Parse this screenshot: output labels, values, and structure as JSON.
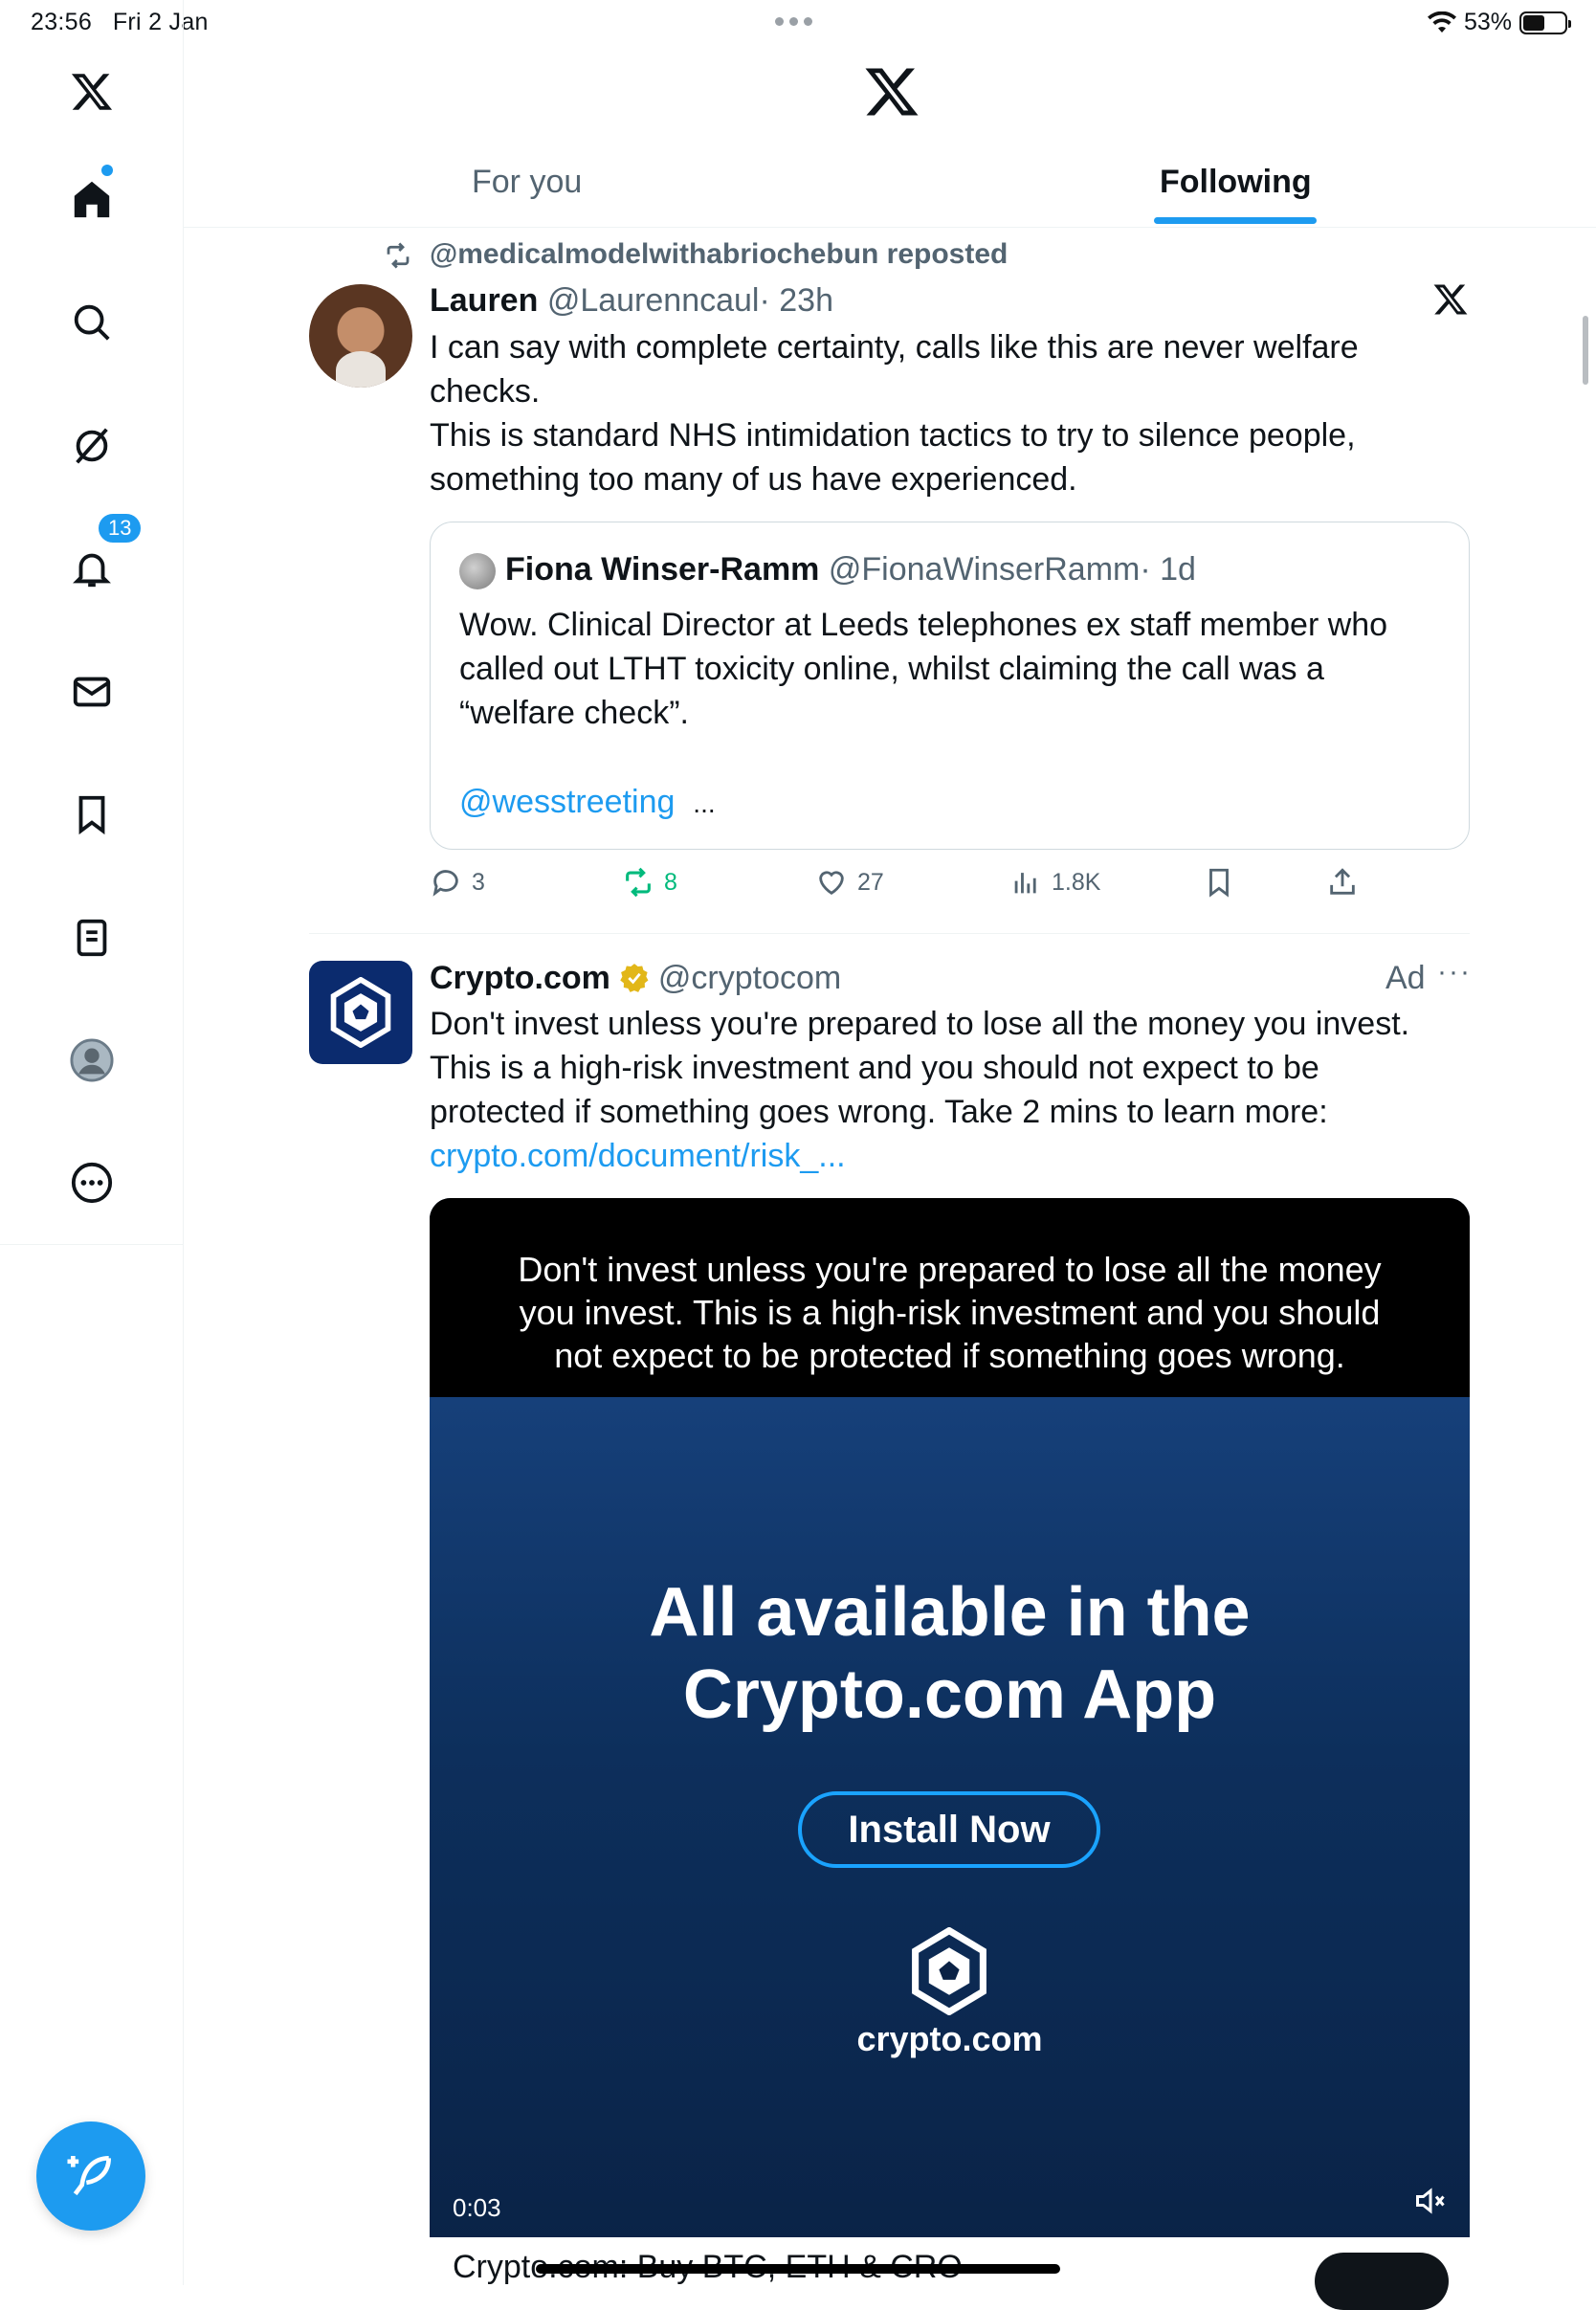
{
  "status_bar": {
    "time": "23:56",
    "date": "Fri 2 Jan",
    "battery": "53%",
    "battery_level": 0.53
  },
  "sidebar": {
    "notifications_badge": "13"
  },
  "tabs": [
    {
      "label": "For you"
    },
    {
      "label": "Following"
    }
  ],
  "post1": {
    "repost_line": "@medicalmodelwithabriochebun reposted",
    "author": "Lauren",
    "handle": "@Laurenncaul",
    "time": "· 23h",
    "text_lines": [
      "I can say with complete certainty, calls like this are never welfare",
      "checks.",
      "This is standard NHS intimidation tactics to try to silence people,",
      "something too many of us have experienced."
    ],
    "quote": {
      "author": "Fiona Winser-Ramm",
      "handle": "@FionaWinserRamm",
      "time": "· 1d",
      "text_lines": [
        "Wow. Clinical Director at Leeds telephones ex staff member who",
        "called out LTHT toxicity online, whilst claiming the call was a",
        "“welfare check”."
      ],
      "mention": "@wesstreeting",
      "ellipsis": "..."
    },
    "actions": {
      "replies": "3",
      "reposts": "8",
      "likes": "27",
      "views": "1.8K"
    }
  },
  "post2": {
    "author": "Crypto.com",
    "handle": "@cryptocom",
    "ad_label": "Ad",
    "text_lines": [
      "Don't invest unless you're prepared to lose all the money you invest.",
      "This is a high-risk investment and you should not expect to be",
      "protected if something goes wrong. Take 2 mins to learn more:"
    ],
    "link": "crypto.com/document/risk_...",
    "media": {
      "warning_lines": [
        "Don't invest unless you're prepared to lose all the money",
        "you invest. This is a high-risk investment and you should",
        "not expect to be protected if something goes wrong."
      ],
      "headline_lines": [
        "All available in the",
        "Crypto.com App"
      ],
      "cta": "Install Now",
      "brand": "crypto.com",
      "timestamp": "0:03"
    },
    "card_title": "Crypto.com: Buy BTC, ETH & CRO"
  }
}
